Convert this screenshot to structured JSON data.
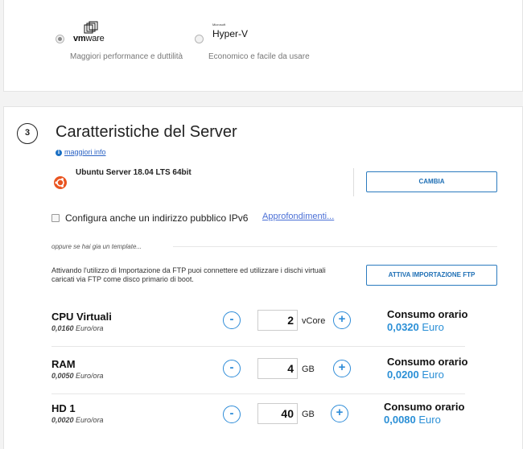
{
  "hypervisor": {
    "options": [
      {
        "name": "vmware",
        "logo_main": "vm",
        "logo_suffix": "ware",
        "description": "Maggiori performance e duttilità",
        "selected": true
      },
      {
        "name": "hyper-v",
        "logo_small": "Microsoft",
        "logo_main": "Hyper-V",
        "description": "Economico e facile da usare",
        "selected": false
      }
    ]
  },
  "step": {
    "number": "3",
    "title": "Caratteristiche del Server",
    "info_link": "maggiori info"
  },
  "os": {
    "name": "Ubuntu Server 18.04 LTS 64bit",
    "icon": "ubuntu-icon",
    "change_button": "CAMBIA"
  },
  "ipv6": {
    "label": "Configura anche un indirizzo pubblico IPv6",
    "checked": false,
    "link": "Approfondimenti..."
  },
  "template_note": "oppure se hai gia un template...",
  "ftp": {
    "text": "Attivando l'utilizzo di Importazione da FTP puoi connettere ed utilizzare i dischi virtuali caricati via FTP come disco primario di boot.",
    "button": "ATTIVA IMPORTAZIONE FTP"
  },
  "resources": [
    {
      "name": "CPU Virtuali",
      "unit_price": "0,0160",
      "price_suffix": "Euro/ora",
      "quantity": "2",
      "unit": "vCore",
      "consumo_label": "Consumo orario",
      "consumo_value": "0,0320",
      "consumo_currency": "Euro"
    },
    {
      "name": "RAM",
      "unit_price": "0,0050",
      "price_suffix": "Euro/ora",
      "quantity": "4",
      "unit": "GB",
      "consumo_label": "Consumo orario",
      "consumo_value": "0,0200",
      "consumo_currency": "Euro"
    },
    {
      "name": "HD 1",
      "unit_price": "0,0020",
      "price_suffix": "Euro/ora",
      "quantity": "40",
      "unit": "GB",
      "consumo_label": "Consumo orario",
      "consumo_value": "0,0080",
      "consumo_currency": "Euro"
    }
  ],
  "controls": {
    "decrement": "-",
    "increment": "+"
  },
  "colors": {
    "accent": "#2e8cd8",
    "ubuntu": "#e95420",
    "link": "#2b63c4"
  }
}
